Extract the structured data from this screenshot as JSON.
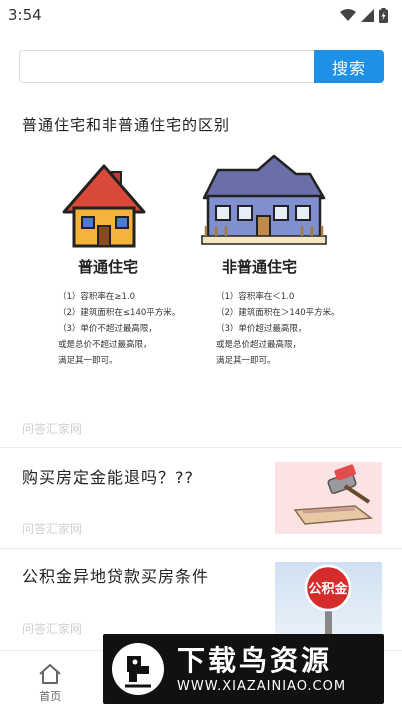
{
  "status": {
    "time": "3:54"
  },
  "search": {
    "placeholder": "",
    "value": "",
    "button_label": "搜索"
  },
  "feature": {
    "title": "普通住宅和非普通住宅的区别",
    "source": "问答汇家网",
    "left_card": {
      "heading": "普通住宅",
      "lines": [
        "（1）容积率在≥1.0",
        "（2）建筑面积在≤140平方米。",
        "（3）单价不超过最高限，",
        "或是总价不超过最高限，",
        "满足其一即可。"
      ]
    },
    "right_card": {
      "heading": "非普通住宅",
      "lines": [
        "（1）容积率在＜1.0",
        "（2）建筑面积在＞140平方米。",
        "（3）单价超过最高限，",
        "或是总价超过最高限，",
        "满足其一即可。"
      ]
    }
  },
  "news": [
    {
      "title": "购买房定金能退吗？??",
      "source": "问答汇家网",
      "thumb_icon": "gavel-money-icon"
    },
    {
      "title": "公积金异地贷款买房条件",
      "source": "问答汇家网",
      "thumb_icon": "housing-fund-sign-icon",
      "thumb_label": "公积金"
    }
  ],
  "tabs": [
    {
      "label": "首页",
      "icon": "home-icon"
    },
    {
      "label": "",
      "icon": "category-icon"
    },
    {
      "label": "",
      "icon": "message-icon"
    },
    {
      "label": "",
      "icon": "profile-icon"
    }
  ],
  "watermark": {
    "title": "下载鸟资源",
    "url": "WWW.XIAZAINIAO.COM"
  },
  "colors": {
    "accent": "#1e90e6",
    "text": "#222222",
    "muted": "#d0d0d0",
    "divider": "#ececec"
  }
}
